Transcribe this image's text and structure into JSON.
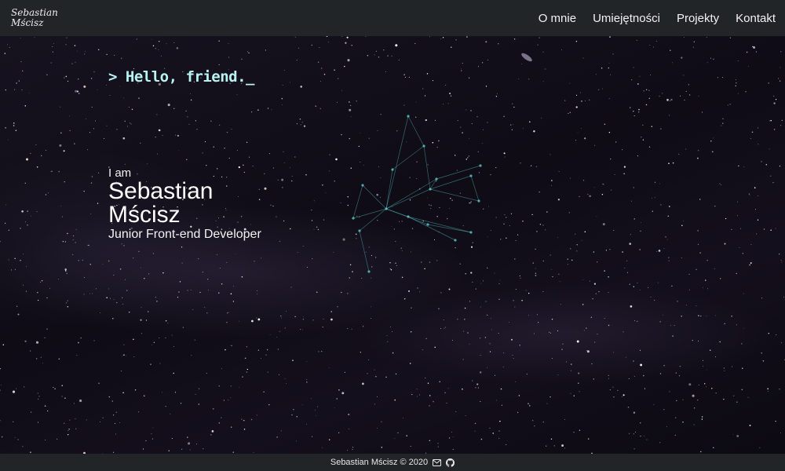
{
  "brand": {
    "line1": "Sebastian",
    "line2": "Mścisz"
  },
  "nav": [
    {
      "label": "O mnie"
    },
    {
      "label": "Umiejętności"
    },
    {
      "label": "Projekty"
    },
    {
      "label": "Kontakt"
    }
  ],
  "hero": {
    "greeting": "> Hello, friend._",
    "intro": "I am",
    "name_line1": "Sebastian",
    "name_line2": "Mścisz",
    "role": "Junior Front-end Developer"
  },
  "footer": {
    "text": "Sebastian Mścisz © 2020",
    "icons": [
      "envelope-icon",
      "github-icon"
    ]
  },
  "colors": {
    "bar": "#212527",
    "greeting": "#b8f2f2",
    "constellation": "#5fd6d6"
  }
}
